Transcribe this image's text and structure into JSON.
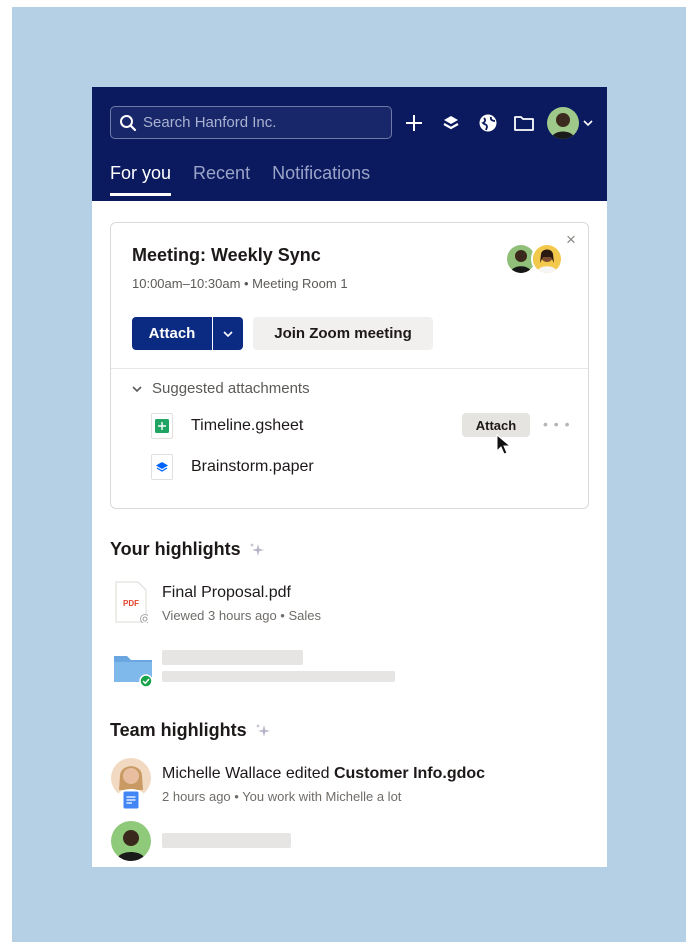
{
  "header": {
    "search_placeholder": "Search Hanford Inc.",
    "icons": [
      "search-icon",
      "plus-icon",
      "dropbox-icon",
      "globe-icon",
      "folder-icon",
      "avatar",
      "chevron-down-icon"
    ],
    "tabs": [
      {
        "label": "For you",
        "active": true
      },
      {
        "label": "Recent",
        "active": false
      },
      {
        "label": "Notifications",
        "active": false
      }
    ]
  },
  "meeting": {
    "title": "Meeting: Weekly Sync",
    "subtitle": "10:00am–10:30am • Meeting Room 1",
    "close_glyph": "×",
    "attach_label": "Attach",
    "zoom_label": "Join Zoom meeting",
    "suggested_label": "Suggested attachments",
    "files": [
      {
        "name": "Timeline.gsheet",
        "icon": "gsheet-icon",
        "action": "Attach"
      },
      {
        "name": "Brainstorm.paper",
        "icon": "paper-icon"
      }
    ],
    "more_glyph": "• • •"
  },
  "your_highlights": {
    "title": "Your highlights",
    "item": {
      "name": "Final Proposal.pdf",
      "meta": "Viewed 3 hours ago • Sales",
      "icon_text": "PDF"
    }
  },
  "team_highlights": {
    "title": "Team highlights",
    "item": {
      "person": "Michelle Wallace",
      "action": " edited ",
      "file": "Customer Info.gdoc",
      "meta": "2 hours ago • You work with Michelle a lot"
    }
  },
  "colors": {
    "header_bg": "#0b1a5e",
    "primary_button": "#0b2a82",
    "backdrop": "#b5d0e4"
  }
}
